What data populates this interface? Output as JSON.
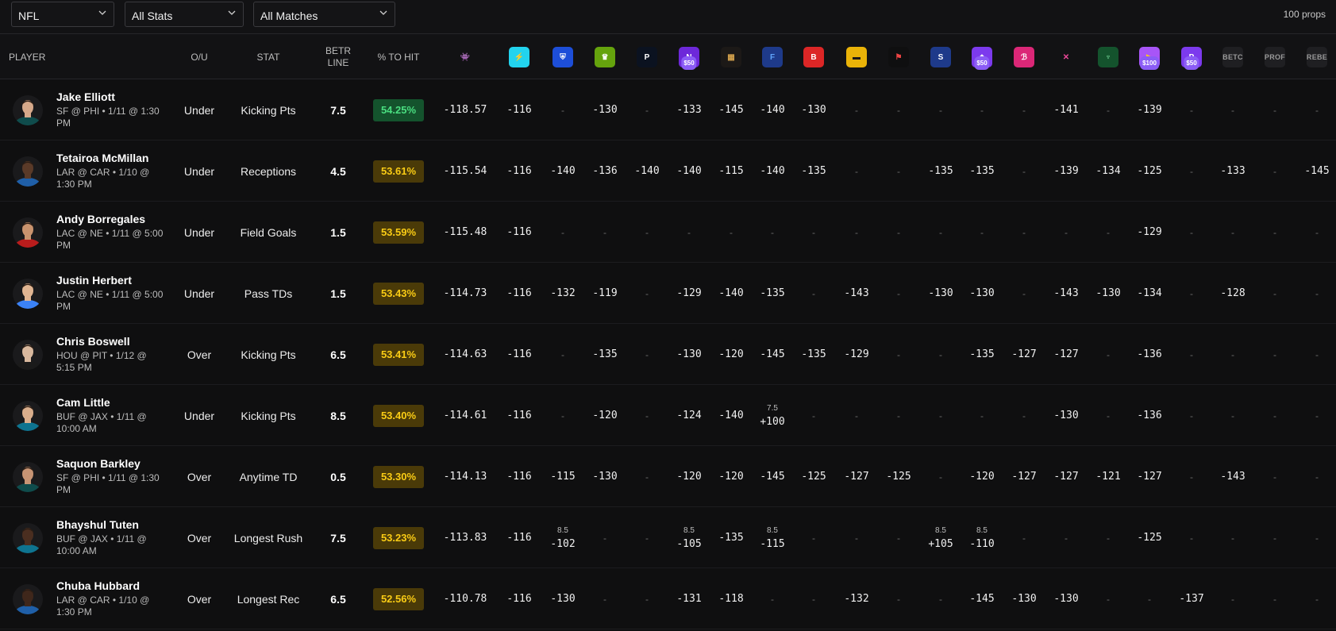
{
  "filters": {
    "league": "NFL",
    "stats": "All Stats",
    "matches": "All Matches"
  },
  "props_count": "100 props",
  "columns": {
    "player": "PLAYER",
    "ou": "O/U",
    "stat": "STAT",
    "betr_line": "BETR LINE",
    "pct_to_hit": "% TO HIT"
  },
  "books": [
    {
      "icon": "purple-monster-icon",
      "bg": "transparent",
      "fg": "#a855f7",
      "glyph": "👾",
      "promo": "",
      "text": ""
    },
    {
      "icon": "lightning-bolt-icon",
      "bg": "#22d3ee",
      "fg": "#7c3aed",
      "glyph": "⚡",
      "promo": "",
      "text": ""
    },
    {
      "icon": "fanduel-shield-icon",
      "bg": "#1d4ed8",
      "fg": "#ffffff",
      "glyph": "⛨",
      "promo": "",
      "text": ""
    },
    {
      "icon": "draftkings-crown-icon",
      "bg": "#65a30d",
      "fg": "#ffffff",
      "glyph": "♛",
      "promo": "",
      "text": ""
    },
    {
      "icon": "p-letter-icon",
      "bg": "#0b1220",
      "fg": "#ffffff",
      "glyph": "P",
      "promo": "",
      "text": ""
    },
    {
      "icon": "n-slash-icon",
      "bg": "#6d28d9",
      "fg": "#ffffff",
      "glyph": "N",
      "promo": "$50",
      "text": ""
    },
    {
      "icon": "betmgm-lion-icon",
      "bg": "#1c1917",
      "fg": "#d4a24c",
      "glyph": "▦",
      "promo": "",
      "text": ""
    },
    {
      "icon": "f-letter-icon",
      "bg": "#1e3a8a",
      "fg": "#60a5fa",
      "glyph": "F",
      "promo": "",
      "text": ""
    },
    {
      "icon": "b-letter-icon",
      "bg": "#dc2626",
      "fg": "#ffffff",
      "glyph": "B",
      "promo": "",
      "text": ""
    },
    {
      "icon": "yellow-badge-icon",
      "bg": "#eab308",
      "fg": "#1c1917",
      "glyph": "▬",
      "promo": "",
      "text": ""
    },
    {
      "icon": "fanatics-flag-icon",
      "bg": "#0f0f10",
      "fg": "#ef4444",
      "glyph": "⚑",
      "promo": "",
      "text": ""
    },
    {
      "icon": "s-letter-icon",
      "bg": "#1e3a8a",
      "fg": "#ffffff",
      "glyph": "S",
      "promo": "",
      "text": ""
    },
    {
      "icon": "purple-badge-icon",
      "bg": "#7c3aed",
      "fg": "#ffffff",
      "glyph": "◆",
      "promo": "$50",
      "text": ""
    },
    {
      "icon": "pink-script-icon",
      "bg": "#db2777",
      "fg": "#ffffff",
      "glyph": "ℬ",
      "promo": "",
      "text": ""
    },
    {
      "icon": "x-cross-icon",
      "bg": "transparent",
      "fg": "#ec4899",
      "glyph": "✕",
      "promo": "",
      "text": ""
    },
    {
      "icon": "trophy-cup-icon",
      "bg": "#14532d",
      "fg": "#86efac",
      "glyph": "♆",
      "promo": "",
      "text": ""
    },
    {
      "icon": "gold-play-icon",
      "bg": "#a855f7",
      "fg": "#facc15",
      "glyph": "▶",
      "promo": "$100",
      "text": ""
    },
    {
      "icon": "p-circle-icon",
      "bg": "#7c3aed",
      "fg": "#ffffff",
      "glyph": "P",
      "promo": "$50",
      "text": ""
    },
    {
      "icon": "betc-text-icon",
      "bg": "#1f1f22",
      "fg": "#9a9a9a",
      "glyph": "",
      "promo": "",
      "text": "BETC"
    },
    {
      "icon": "prop-text-icon",
      "bg": "#1f1f22",
      "fg": "#9a9a9a",
      "glyph": "",
      "promo": "",
      "text": "PROF"
    },
    {
      "icon": "rebe-text-icon",
      "bg": "#1f1f22",
      "fg": "#9a9a9a",
      "glyph": "",
      "promo": "",
      "text": "REBE"
    }
  ],
  "rows": [
    {
      "name": "Jake Elliott",
      "game": "SF @ PHI • 1/11 @ 1:30 PM",
      "ou": "Under",
      "stat": "Kicking Pts",
      "line": "7.5",
      "pct": "54.25%",
      "pct_tier": "green",
      "fair": "-118.57",
      "avatar_skin": "#d6a98a",
      "avatar_shirt": "#0f4c4c",
      "odds": [
        {
          "v": "-116"
        },
        {
          "v": "-"
        },
        {
          "v": "-130"
        },
        {
          "v": "-"
        },
        {
          "v": "-133"
        },
        {
          "v": "-145"
        },
        {
          "v": "-140"
        },
        {
          "v": "-130"
        },
        {
          "v": "-"
        },
        {
          "v": "-"
        },
        {
          "v": "-"
        },
        {
          "v": "-"
        },
        {
          "v": "-"
        },
        {
          "v": "-141"
        },
        {
          "v": "-"
        },
        {
          "v": "-139"
        },
        {
          "v": "-"
        },
        {
          "v": "-"
        },
        {
          "v": "-"
        },
        {
          "v": "-"
        }
      ]
    },
    {
      "name": "Tetairoa McMillan",
      "game": "LAR @ CAR • 1/10 @ 1:30 PM",
      "ou": "Under",
      "stat": "Receptions",
      "line": "4.5",
      "pct": "53.61%",
      "pct_tier": "gold",
      "fair": "-115.54",
      "avatar_skin": "#5a3a28",
      "avatar_shirt": "#1f5fa8",
      "odds": [
        {
          "v": "-116"
        },
        {
          "v": "-140"
        },
        {
          "v": "-136"
        },
        {
          "v": "-140"
        },
        {
          "v": "-140"
        },
        {
          "v": "-115"
        },
        {
          "v": "-140"
        },
        {
          "v": "-135"
        },
        {
          "v": "-"
        },
        {
          "v": "-"
        },
        {
          "v": "-135"
        },
        {
          "v": "-135"
        },
        {
          "v": "-"
        },
        {
          "v": "-139"
        },
        {
          "v": "-134"
        },
        {
          "v": "-125"
        },
        {
          "v": "-"
        },
        {
          "v": "-133"
        },
        {
          "v": "-"
        },
        {
          "v": "-145"
        }
      ]
    },
    {
      "name": "Andy Borregales",
      "game": "LAC @ NE • 1/11 @ 5:00 PM",
      "ou": "Under",
      "stat": "Field Goals",
      "line": "1.5",
      "pct": "53.59%",
      "pct_tier": "gold",
      "fair": "-115.48",
      "avatar_skin": "#c9936e",
      "avatar_shirt": "#b91c1c",
      "odds": [
        {
          "v": "-116"
        },
        {
          "v": "-"
        },
        {
          "v": "-"
        },
        {
          "v": "-"
        },
        {
          "v": "-"
        },
        {
          "v": "-"
        },
        {
          "v": "-"
        },
        {
          "v": "-"
        },
        {
          "v": "-"
        },
        {
          "v": "-"
        },
        {
          "v": "-"
        },
        {
          "v": "-"
        },
        {
          "v": "-"
        },
        {
          "v": "-"
        },
        {
          "v": "-"
        },
        {
          "v": "-129"
        },
        {
          "v": "-"
        },
        {
          "v": "-"
        },
        {
          "v": "-"
        },
        {
          "v": "-"
        }
      ]
    },
    {
      "name": "Justin Herbert",
      "game": "LAC @ NE • 1/11 @ 5:00 PM",
      "ou": "Under",
      "stat": "Pass TDs",
      "line": "1.5",
      "pct": "53.43%",
      "pct_tier": "gold",
      "fair": "-114.73",
      "avatar_skin": "#e0b592",
      "avatar_shirt": "#3b82f6",
      "odds": [
        {
          "v": "-116"
        },
        {
          "v": "-132"
        },
        {
          "v": "-119"
        },
        {
          "v": "-"
        },
        {
          "v": "-129"
        },
        {
          "v": "-140"
        },
        {
          "v": "-135"
        },
        {
          "v": "-"
        },
        {
          "v": "-143"
        },
        {
          "v": "-"
        },
        {
          "v": "-130"
        },
        {
          "v": "-130"
        },
        {
          "v": "-"
        },
        {
          "v": "-143"
        },
        {
          "v": "-130"
        },
        {
          "v": "-134"
        },
        {
          "v": "-"
        },
        {
          "v": "-128"
        },
        {
          "v": "-"
        },
        {
          "v": "-"
        }
      ]
    },
    {
      "name": "Chris Boswell",
      "game": "HOU @ PIT • 1/12 @ 5:15 PM",
      "ou": "Over",
      "stat": "Kicking Pts",
      "line": "6.5",
      "pct": "53.41%",
      "pct_tier": "gold",
      "fair": "-114.63",
      "avatar_skin": "#d8b89e",
      "avatar_shirt": "#1a1a1a",
      "odds": [
        {
          "v": "-116"
        },
        {
          "v": "-"
        },
        {
          "v": "-135"
        },
        {
          "v": "-"
        },
        {
          "v": "-130"
        },
        {
          "v": "-120"
        },
        {
          "v": "-145"
        },
        {
          "v": "-135"
        },
        {
          "v": "-129"
        },
        {
          "v": "-"
        },
        {
          "v": "-"
        },
        {
          "v": "-135"
        },
        {
          "v": "-127"
        },
        {
          "v": "-127"
        },
        {
          "v": "-"
        },
        {
          "v": "-136"
        },
        {
          "v": "-"
        },
        {
          "v": "-"
        },
        {
          "v": "-"
        },
        {
          "v": "-"
        }
      ]
    },
    {
      "name": "Cam Little",
      "game": "BUF @ JAX • 1/11 @ 10:00 AM",
      "ou": "Under",
      "stat": "Kicking Pts",
      "line": "8.5",
      "pct": "53.40%",
      "pct_tier": "gold",
      "fair": "-114.61",
      "avatar_skin": "#d9ae8c",
      "avatar_shirt": "#0e7490",
      "odds": [
        {
          "v": "-116"
        },
        {
          "v": "-"
        },
        {
          "v": "-120"
        },
        {
          "v": "-"
        },
        {
          "v": "-124"
        },
        {
          "v": "-140"
        },
        {
          "v": "+100",
          "alt": "7.5"
        },
        {
          "v": "-"
        },
        {
          "v": "-"
        },
        {
          "v": "-"
        },
        {
          "v": "-"
        },
        {
          "v": "-"
        },
        {
          "v": "-"
        },
        {
          "v": "-130"
        },
        {
          "v": "-"
        },
        {
          "v": "-136"
        },
        {
          "v": "-"
        },
        {
          "v": "-"
        },
        {
          "v": "-"
        },
        {
          "v": "-"
        }
      ]
    },
    {
      "name": "Saquon Barkley",
      "game": "SF @ PHI • 1/11 @ 1:30 PM",
      "ou": "Over",
      "stat": "Anytime TD",
      "line": "0.5",
      "pct": "53.30%",
      "pct_tier": "gold",
      "fair": "-114.13",
      "avatar_skin": "#c69474",
      "avatar_shirt": "#0f4c4c",
      "odds": [
        {
          "v": "-116"
        },
        {
          "v": "-115"
        },
        {
          "v": "-130"
        },
        {
          "v": "-"
        },
        {
          "v": "-120"
        },
        {
          "v": "-120"
        },
        {
          "v": "-145"
        },
        {
          "v": "-125"
        },
        {
          "v": "-127"
        },
        {
          "v": "-125"
        },
        {
          "v": "-"
        },
        {
          "v": "-120"
        },
        {
          "v": "-127"
        },
        {
          "v": "-127"
        },
        {
          "v": "-121"
        },
        {
          "v": "-127"
        },
        {
          "v": "-"
        },
        {
          "v": "-143"
        },
        {
          "v": "-"
        },
        {
          "v": "-"
        }
      ]
    },
    {
      "name": "Bhayshul Tuten",
      "game": "BUF @ JAX • 1/11 @ 10:00 AM",
      "ou": "Over",
      "stat": "Longest Rush",
      "line": "7.5",
      "pct": "53.23%",
      "pct_tier": "gold",
      "fair": "-113.83",
      "avatar_skin": "#4a2e20",
      "avatar_shirt": "#0e7490",
      "odds": [
        {
          "v": "-116"
        },
        {
          "v": "-102",
          "alt": "8.5"
        },
        {
          "v": "-"
        },
        {
          "v": "-"
        },
        {
          "v": "-105",
          "alt": "8.5"
        },
        {
          "v": "-135"
        },
        {
          "v": "-115",
          "alt": "8.5"
        },
        {
          "v": "-"
        },
        {
          "v": "-"
        },
        {
          "v": "-"
        },
        {
          "v": "+105",
          "alt": "8.5"
        },
        {
          "v": "-110",
          "alt": "8.5"
        },
        {
          "v": "-"
        },
        {
          "v": "-"
        },
        {
          "v": "-"
        },
        {
          "v": "-125"
        },
        {
          "v": "-"
        },
        {
          "v": "-"
        },
        {
          "v": "-"
        },
        {
          "v": "-"
        }
      ]
    },
    {
      "name": "Chuba Hubbard",
      "game": "LAR @ CAR • 1/10 @ 1:30 PM",
      "ou": "Over",
      "stat": "Longest Rec",
      "line": "6.5",
      "pct": "52.56%",
      "pct_tier": "gold",
      "fair": "-110.78",
      "avatar_skin": "#3f271b",
      "avatar_shirt": "#1f5fa8",
      "odds": [
        {
          "v": "-116"
        },
        {
          "v": "-130"
        },
        {
          "v": "-"
        },
        {
          "v": "-"
        },
        {
          "v": "-131"
        },
        {
          "v": "-118"
        },
        {
          "v": "-"
        },
        {
          "v": "-"
        },
        {
          "v": "-132"
        },
        {
          "v": "-"
        },
        {
          "v": "-"
        },
        {
          "v": "-145"
        },
        {
          "v": "-130"
        },
        {
          "v": "-130"
        },
        {
          "v": "-"
        },
        {
          "v": "-"
        },
        {
          "v": "-137"
        },
        {
          "v": "-"
        },
        {
          "v": "-"
        },
        {
          "v": "-"
        }
      ]
    }
  ],
  "tier_colors": {
    "green": {
      "bg": "#14532d",
      "fg": "#4ade80"
    },
    "gold": {
      "bg": "#4a3a08",
      "fg": "#facc15"
    }
  }
}
